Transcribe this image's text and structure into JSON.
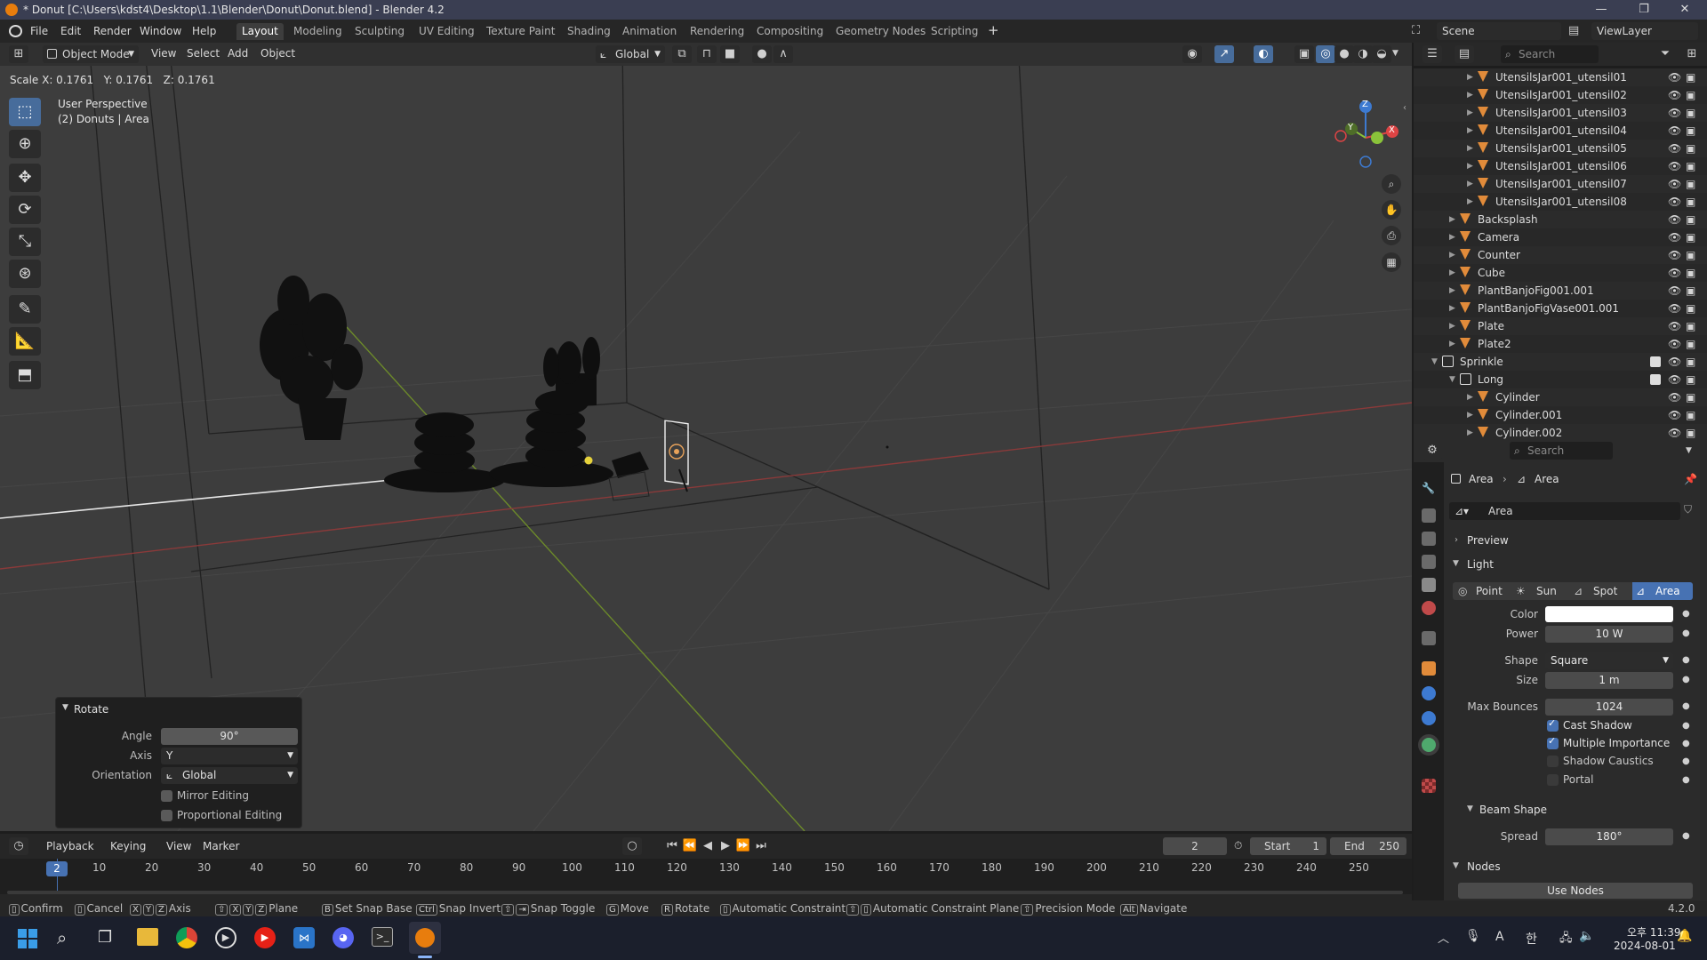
{
  "window": {
    "title": "* Donut [C:\\Users\\kdst4\\Desktop\\1.1\\Blender\\Donut\\Donut.blend] - Blender 4.2"
  },
  "menu": [
    "File",
    "Edit",
    "Render",
    "Window",
    "Help"
  ],
  "workspaces": [
    "Layout",
    "Modeling",
    "Sculpting",
    "UV Editing",
    "Texture Paint",
    "Shading",
    "Animation",
    "Rendering",
    "Compositing",
    "Geometry Nodes",
    "Scripting"
  ],
  "scene": {
    "label": "Scene",
    "view_layer": "ViewLayer"
  },
  "viewport": {
    "mode": "Object Mode",
    "menus": [
      "View",
      "Select",
      "Add",
      "Object"
    ],
    "orientation": "Global",
    "status_line": "Scale X: 0.1761   Y: 0.1761   Z: 0.1761",
    "overlay_title": "User Perspective",
    "overlay_sub": "(2) Donuts | Area",
    "gizmo": {
      "x": "X",
      "y": "Y",
      "z": "Z"
    }
  },
  "redo_panel": {
    "title": "Rotate",
    "angle_label": "Angle",
    "angle": "90°",
    "axis_label": "Axis",
    "axis": "Y",
    "orientation_label": "Orientation",
    "orientation": "Global",
    "mirror": "Mirror Editing",
    "proportional": "Proportional Editing"
  },
  "outliner": {
    "search_placeholder": "Search",
    "rows": [
      {
        "label": "UtensilsJar001_utensil01",
        "indent": 3
      },
      {
        "label": "UtensilsJar001_utensil02",
        "indent": 3
      },
      {
        "label": "UtensilsJar001_utensil03",
        "indent": 3
      },
      {
        "label": "UtensilsJar001_utensil04",
        "indent": 3
      },
      {
        "label": "UtensilsJar001_utensil05",
        "indent": 3
      },
      {
        "label": "UtensilsJar001_utensil06",
        "indent": 3
      },
      {
        "label": "UtensilsJar001_utensil07",
        "indent": 3
      },
      {
        "label": "UtensilsJar001_utensil08",
        "indent": 3
      },
      {
        "label": "Backsplash",
        "indent": 2
      },
      {
        "label": "Camera",
        "indent": 2
      },
      {
        "label": "Counter",
        "indent": 2
      },
      {
        "label": "Cube",
        "indent": 2
      },
      {
        "label": "PlantBanjoFig001.001",
        "indent": 2
      },
      {
        "label": "PlantBanjoFigVase001.001",
        "indent": 2
      },
      {
        "label": "Plate",
        "indent": 2
      },
      {
        "label": "Plate2",
        "indent": 2
      },
      {
        "label": "Sprinkle",
        "indent": 1
      },
      {
        "label": "Long",
        "indent": 2
      },
      {
        "label": "Cylinder",
        "indent": 3
      },
      {
        "label": "Cylinder.001",
        "indent": 3
      },
      {
        "label": "Cylinder.002",
        "indent": 3
      }
    ]
  },
  "properties": {
    "search_placeholder": "Search",
    "breadcrumb_object": "Area",
    "breadcrumb_data": "Area",
    "datablock": "Area",
    "preview": "Preview",
    "light": "Light",
    "light_types": [
      "Point",
      "Sun",
      "Spot",
      "Area"
    ],
    "color_label": "Color",
    "power_label": "Power",
    "power": "10 W",
    "shape_label": "Shape",
    "shape": "Square",
    "size_label": "Size",
    "size": "1 m",
    "bounces_label": "Max Bounces",
    "bounces": "1024",
    "cast_shadow": "Cast Shadow",
    "multi_importance": "Multiple Importance",
    "shadow_caustics": "Shadow Caustics",
    "portal": "Portal",
    "beam_shape": "Beam Shape",
    "spread_label": "Spread",
    "spread": "180°",
    "nodes": "Nodes",
    "use_nodes": "Use Nodes"
  },
  "timeline": {
    "menus": [
      "Playback",
      "Keying",
      "View",
      "Marker"
    ],
    "current_frame": "2",
    "start_label": "Start",
    "start": "1",
    "end_label": "End",
    "end": "250",
    "frame_badge": "2",
    "ticks": [
      "10",
      "20",
      "30",
      "40",
      "50",
      "60",
      "70",
      "80",
      "90",
      "100",
      "110",
      "120",
      "130",
      "140",
      "150",
      "160",
      "170",
      "180",
      "190",
      "200",
      "210",
      "220",
      "230",
      "240",
      "250"
    ]
  },
  "statusbar": {
    "items": [
      "Confirm",
      "Cancel",
      "Axis",
      "Plane",
      "Set Snap Base",
      "Snap Invert",
      "Snap Toggle",
      "Move",
      "Rotate",
      "Automatic Constraint",
      "Automatic Constraint Plane",
      "Precision Mode",
      "Navigate"
    ],
    "version": "4.2.0"
  },
  "taskbar": {
    "time": "오후 11:39",
    "date": "2024-08-01",
    "ime": "A",
    "hangul": "한"
  }
}
